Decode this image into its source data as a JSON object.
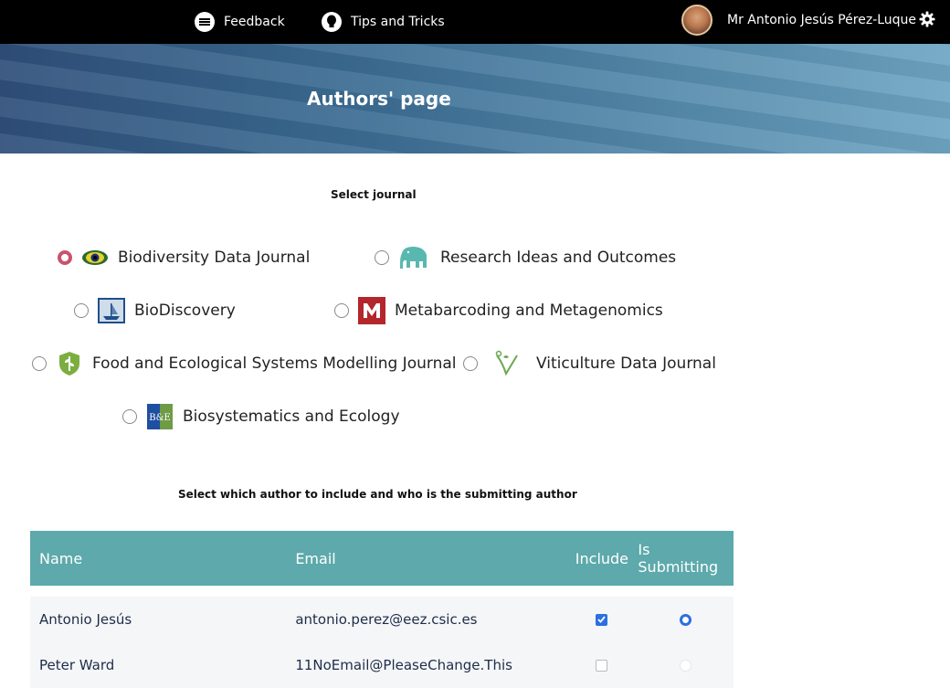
{
  "topbar": {
    "feedback": "Feedback",
    "tips": "Tips and Tricks",
    "user": "Mr Antonio Jesús Pérez-Luque"
  },
  "banner": {
    "title": "Authors' page"
  },
  "select_journal": {
    "label": "Select journal",
    "journals": [
      {
        "name": "Biodiversity Data Journal",
        "selected": true
      },
      {
        "name": "Research Ideas and Outcomes",
        "selected": false
      },
      {
        "name": "BioDiscovery",
        "selected": false
      },
      {
        "name": "Metabarcoding and Metagenomics",
        "selected": false
      },
      {
        "name": "Food and Ecological Systems Modelling Journal",
        "selected": false
      },
      {
        "name": "Viticulture Data Journal",
        "selected": false
      },
      {
        "name": "Biosystematics and Ecology",
        "selected": false
      }
    ]
  },
  "authors": {
    "label": "Select which author to include and who is the submitting author",
    "columns": [
      "Name",
      "Email",
      "Include",
      "Is Submitting"
    ],
    "rows": [
      {
        "name": "Antonio Jesús",
        "email": "antonio.perez@eez.csic.es",
        "include": true,
        "submitting": true
      },
      {
        "name": "Peter Ward",
        "email": "11NoEmail@PleaseChange.This",
        "include": false,
        "submitting": false
      }
    ]
  },
  "colors": {
    "header_bg": "#000000",
    "table_header": "#5da9ab",
    "selected_radio": "#c8546c",
    "checkbox_blue": "#2b6fe0"
  }
}
